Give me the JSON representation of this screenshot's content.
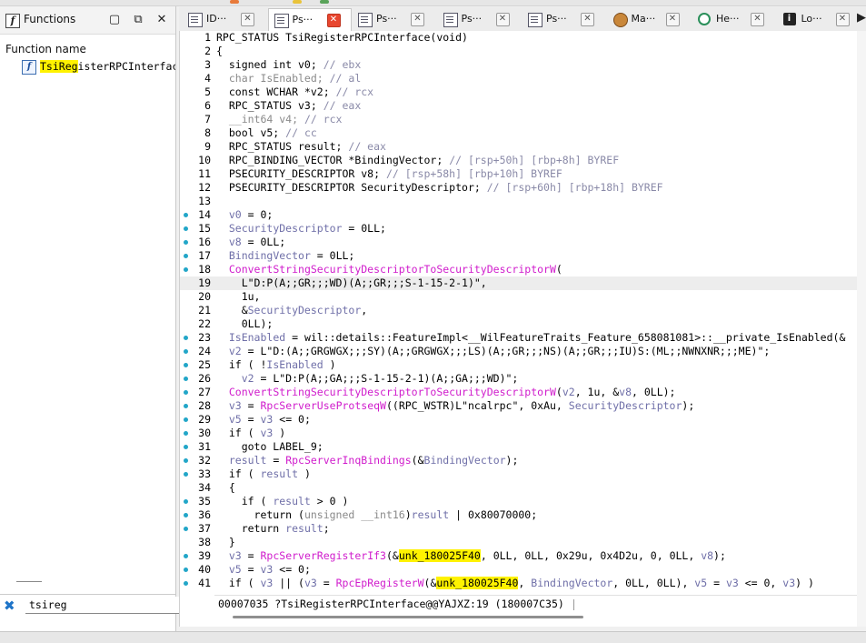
{
  "functions_panel": {
    "title": "Functions",
    "column_header": "Function name",
    "items": [
      {
        "name_highlight": "TsiReg",
        "name_rest": "isterRPCInterface("
      }
    ],
    "filter_value": "tsireg"
  },
  "tabs": [
    {
      "label": "ID···",
      "icon": "doc-icon",
      "active": false
    },
    {
      "label": "Ps···",
      "icon": "doc-icon",
      "active": true
    },
    {
      "label": "Ps···",
      "icon": "doc-icon",
      "active": false
    },
    {
      "label": "Ps···",
      "icon": "doc-icon",
      "active": false
    },
    {
      "label": "Ps···",
      "icon": "doc-icon",
      "active": false
    },
    {
      "label": "Ma···",
      "icon": "face-icon",
      "active": false
    },
    {
      "label": "He···",
      "icon": "hex-icon",
      "active": false
    },
    {
      "label": "Lo···",
      "icon": "info-icon",
      "active": false
    }
  ],
  "code": {
    "current_line": 19,
    "lines": [
      {
        "n": 1,
        "bp": false,
        "t": [
          [
            "k",
            "RPC_STATUS TsiRegisterRPCInterface(void)"
          ]
        ]
      },
      {
        "n": 2,
        "bp": false,
        "t": [
          [
            "k",
            "{"
          ]
        ]
      },
      {
        "n": 3,
        "bp": false,
        "t": [
          [
            "k",
            "  signed int v0; "
          ],
          [
            "c",
            "// ebx"
          ]
        ]
      },
      {
        "n": 4,
        "bp": false,
        "t": [
          [
            "gr",
            "  char IsEnabled; "
          ],
          [
            "c",
            "// al"
          ]
        ]
      },
      {
        "n": 5,
        "bp": false,
        "t": [
          [
            "k",
            "  const WCHAR *v2; "
          ],
          [
            "c",
            "// rcx"
          ]
        ]
      },
      {
        "n": 6,
        "bp": false,
        "t": [
          [
            "k",
            "  RPC_STATUS v3; "
          ],
          [
            "c",
            "// eax"
          ]
        ]
      },
      {
        "n": 7,
        "bp": false,
        "t": [
          [
            "gr",
            "  __int64 v4; "
          ],
          [
            "c",
            "// rcx"
          ]
        ]
      },
      {
        "n": 8,
        "bp": false,
        "t": [
          [
            "k",
            "  bool v5; "
          ],
          [
            "c",
            "// cc"
          ]
        ]
      },
      {
        "n": 9,
        "bp": false,
        "t": [
          [
            "k",
            "  RPC_STATUS result; "
          ],
          [
            "c",
            "// eax"
          ]
        ]
      },
      {
        "n": 10,
        "bp": false,
        "t": [
          [
            "k",
            "  RPC_BINDING_VECTOR *BindingVector; "
          ],
          [
            "c",
            "// [rsp+50h] [rbp+8h] BYREF"
          ]
        ]
      },
      {
        "n": 11,
        "bp": false,
        "t": [
          [
            "k",
            "  PSECURITY_DESCRIPTOR v8; "
          ],
          [
            "c",
            "// [rsp+58h] [rbp+10h] BYREF"
          ]
        ]
      },
      {
        "n": 12,
        "bp": false,
        "t": [
          [
            "k",
            "  PSECURITY_DESCRIPTOR SecurityDescriptor; "
          ],
          [
            "c",
            "// [rsp+60h] [rbp+18h] BYREF"
          ]
        ]
      },
      {
        "n": 13,
        "bp": false,
        "t": [
          [
            "k",
            ""
          ]
        ]
      },
      {
        "n": 14,
        "bp": true,
        "t": [
          [
            "k",
            "  "
          ],
          [
            "v",
            "v0"
          ],
          [
            "k",
            " = 0;"
          ]
        ]
      },
      {
        "n": 15,
        "bp": true,
        "t": [
          [
            "k",
            "  "
          ],
          [
            "v",
            "SecurityDescriptor"
          ],
          [
            "k",
            " = 0LL;"
          ]
        ]
      },
      {
        "n": 16,
        "bp": true,
        "t": [
          [
            "k",
            "  "
          ],
          [
            "v",
            "v8"
          ],
          [
            "k",
            " = 0LL;"
          ]
        ]
      },
      {
        "n": 17,
        "bp": true,
        "t": [
          [
            "k",
            "  "
          ],
          [
            "v",
            "BindingVector"
          ],
          [
            "k",
            " = 0LL;"
          ]
        ]
      },
      {
        "n": 18,
        "bp": true,
        "t": [
          [
            "k",
            "  "
          ],
          [
            "f",
            "ConvertStringSecurityDescriptorToSecurityDescriptorW"
          ],
          [
            "k",
            "("
          ]
        ]
      },
      {
        "n": 19,
        "bp": false,
        "t": [
          [
            "k",
            "    L\"D:P(A;;GR;;;WD)(A;;GR;;;S-1-15-2-1)\","
          ]
        ]
      },
      {
        "n": 20,
        "bp": false,
        "t": [
          [
            "k",
            "    1u,"
          ]
        ]
      },
      {
        "n": 21,
        "bp": false,
        "t": [
          [
            "k",
            "    &"
          ],
          [
            "v",
            "SecurityDescriptor"
          ],
          [
            "k",
            ","
          ]
        ]
      },
      {
        "n": 22,
        "bp": false,
        "t": [
          [
            "k",
            "    0LL);"
          ]
        ]
      },
      {
        "n": 23,
        "bp": true,
        "t": [
          [
            "k",
            "  "
          ],
          [
            "v",
            "IsEnabled"
          ],
          [
            "k",
            " = wil::details::FeatureImpl<__WilFeatureTraits_Feature_658081081>::__private_IsEnabled(&"
          ]
        ]
      },
      {
        "n": 24,
        "bp": true,
        "t": [
          [
            "k",
            "  "
          ],
          [
            "v",
            "v2"
          ],
          [
            "k",
            " = L\"D:(A;;GRGWGX;;;SY)(A;;GRGWGX;;;LS)(A;;GR;;;NS)(A;;GR;;;IU)S:(ML;;NWNXNR;;;ME)\";"
          ]
        ]
      },
      {
        "n": 25,
        "bp": true,
        "t": [
          [
            "k",
            "  if ( !"
          ],
          [
            "v",
            "IsEnabled"
          ],
          [
            "k",
            " )"
          ]
        ]
      },
      {
        "n": 26,
        "bp": true,
        "t": [
          [
            "k",
            "    "
          ],
          [
            "v",
            "v2"
          ],
          [
            "k",
            " = L\"D:P(A;;GA;;;S-1-15-2-1)(A;;GA;;;WD)\";"
          ]
        ]
      },
      {
        "n": 27,
        "bp": true,
        "t": [
          [
            "k",
            "  "
          ],
          [
            "f",
            "ConvertStringSecurityDescriptorToSecurityDescriptorW"
          ],
          [
            "k",
            "("
          ],
          [
            "v",
            "v2"
          ],
          [
            "k",
            ", 1u, &"
          ],
          [
            "v",
            "v8"
          ],
          [
            "k",
            ", 0LL);"
          ]
        ]
      },
      {
        "n": 28,
        "bp": true,
        "t": [
          [
            "k",
            "  "
          ],
          [
            "v",
            "v3"
          ],
          [
            "k",
            " = "
          ],
          [
            "f",
            "RpcServerUseProtseqW"
          ],
          [
            "k",
            "((RPC_WSTR)L\"ncalrpc\", 0xAu, "
          ],
          [
            "v",
            "SecurityDescriptor"
          ],
          [
            "k",
            ");"
          ]
        ]
      },
      {
        "n": 29,
        "bp": true,
        "t": [
          [
            "k",
            "  "
          ],
          [
            "v",
            "v5"
          ],
          [
            "k",
            " = "
          ],
          [
            "v",
            "v3"
          ],
          [
            "k",
            " <= 0;"
          ]
        ]
      },
      {
        "n": 30,
        "bp": true,
        "t": [
          [
            "k",
            "  if ( "
          ],
          [
            "v",
            "v3"
          ],
          [
            "k",
            " )"
          ]
        ]
      },
      {
        "n": 31,
        "bp": true,
        "t": [
          [
            "k",
            "    goto LABEL_9;"
          ]
        ]
      },
      {
        "n": 32,
        "bp": true,
        "t": [
          [
            "k",
            "  "
          ],
          [
            "v",
            "result"
          ],
          [
            "k",
            " = "
          ],
          [
            "f",
            "RpcServerInqBindings"
          ],
          [
            "k",
            "(&"
          ],
          [
            "v",
            "BindingVector"
          ],
          [
            "k",
            ");"
          ]
        ]
      },
      {
        "n": 33,
        "bp": true,
        "t": [
          [
            "k",
            "  if ( "
          ],
          [
            "v",
            "result"
          ],
          [
            "k",
            " )"
          ]
        ]
      },
      {
        "n": 34,
        "bp": false,
        "t": [
          [
            "k",
            "  {"
          ]
        ]
      },
      {
        "n": 35,
        "bp": true,
        "t": [
          [
            "k",
            "    if ( "
          ],
          [
            "v",
            "result"
          ],
          [
            "k",
            " > 0 )"
          ]
        ]
      },
      {
        "n": 36,
        "bp": true,
        "t": [
          [
            "k",
            "      return ("
          ],
          [
            "gr",
            "unsigned __int16"
          ],
          [
            "k",
            ")"
          ],
          [
            "v",
            "result"
          ],
          [
            "k",
            " | 0x80070000;"
          ]
        ]
      },
      {
        "n": 37,
        "bp": true,
        "t": [
          [
            "k",
            "    return "
          ],
          [
            "v",
            "result"
          ],
          [
            "k",
            ";"
          ]
        ]
      },
      {
        "n": 38,
        "bp": false,
        "t": [
          [
            "k",
            "  }"
          ]
        ]
      },
      {
        "n": 39,
        "bp": true,
        "t": [
          [
            "k",
            "  "
          ],
          [
            "v",
            "v3"
          ],
          [
            "k",
            " = "
          ],
          [
            "f",
            "RpcServerRegisterIf3"
          ],
          [
            "k",
            "(&"
          ],
          [
            "hy",
            "unk_180025F40"
          ],
          [
            "k",
            ", 0LL, 0LL, 0x29u, 0x4D2u, 0, 0LL, "
          ],
          [
            "v",
            "v8"
          ],
          [
            "k",
            ");"
          ]
        ]
      },
      {
        "n": 40,
        "bp": true,
        "t": [
          [
            "k",
            "  "
          ],
          [
            "v",
            "v5"
          ],
          [
            "k",
            " = "
          ],
          [
            "v",
            "v3"
          ],
          [
            "k",
            " <= 0;"
          ]
        ]
      },
      {
        "n": 41,
        "bp": true,
        "t": [
          [
            "k",
            "  if ( "
          ],
          [
            "v",
            "v3"
          ],
          [
            "k",
            " || ("
          ],
          [
            "v",
            "v3"
          ],
          [
            "k",
            " = "
          ],
          [
            "f",
            "RpcEpRegisterW"
          ],
          [
            "k",
            "(&"
          ],
          [
            "hy",
            "unk_180025F40"
          ],
          [
            "k",
            ", "
          ],
          [
            "v",
            "BindingVector"
          ],
          [
            "k",
            ", 0LL, 0LL), "
          ],
          [
            "v",
            "v5"
          ],
          [
            "k",
            " = "
          ],
          [
            "v",
            "v3"
          ],
          [
            "k",
            " <= 0, "
          ],
          [
            "v",
            "v3"
          ],
          [
            "k",
            ") )"
          ]
        ]
      }
    ]
  },
  "status_bar": {
    "text": "00007035 ?TsiRegisterRPCInterface@@YAJXZ:19 (180007C35)"
  },
  "colors": {
    "highlight": "#fff200",
    "function": "#d01ccc",
    "variable": "#6f6fa8",
    "comment": "#8a8aa8",
    "breakpoint_dot": "#22a6c8",
    "active_tab_close": "#e8462f"
  }
}
